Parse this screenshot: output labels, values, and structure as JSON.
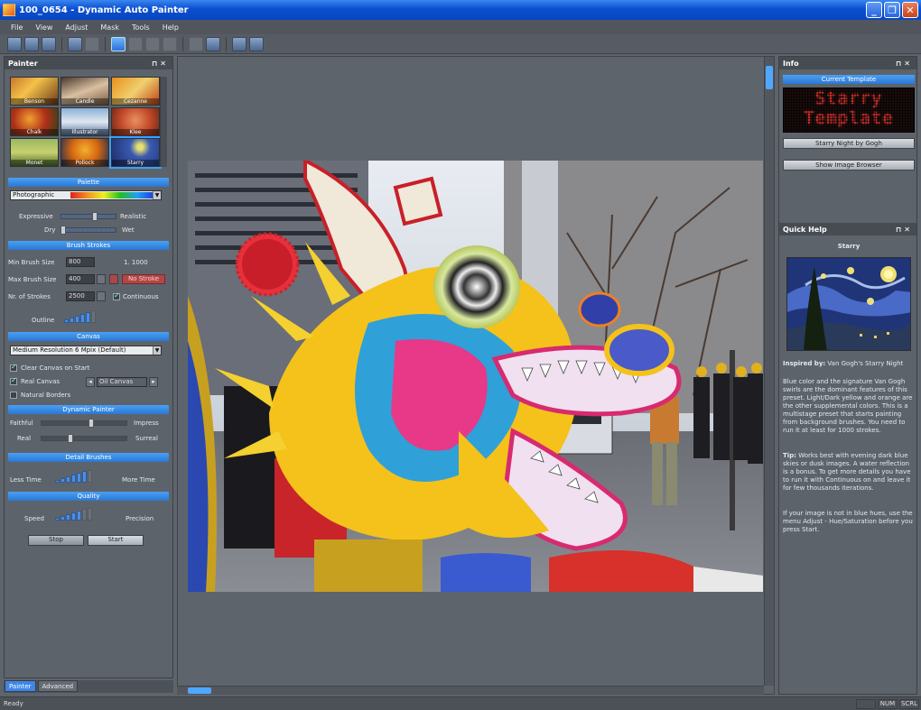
{
  "window": {
    "title": "100_0654 - Dynamic Auto Painter"
  },
  "menu": [
    "File",
    "View",
    "Adjust",
    "Mask",
    "Tools",
    "Help"
  ],
  "painter_panel": {
    "title": "Painter",
    "thumbnails": [
      "Benson",
      "Candle",
      "Cezanne",
      "Chalk",
      "Illustrator",
      "Klee",
      "Monet",
      "Pollock",
      "Starry"
    ],
    "palette": {
      "header": "Palette",
      "value": "Photographic",
      "expressive_label": "Expressive",
      "realistic_label": "Realistic",
      "dry_label": "Dry",
      "wet_label": "Wet"
    },
    "brush_strokes": {
      "header": "Brush Strokes",
      "min_label": "Min Brush Size",
      "min_value": "800",
      "ratio": "1. 1000",
      "max_label": "Max Brush Size",
      "max_value": "400",
      "no_stroke_label": "No Stroke",
      "strokes_label": "Nr. of Strokes",
      "strokes_value": "2500",
      "continuous_label": "Continuous",
      "outline_label": "Outline"
    },
    "canvas": {
      "header": "Canvas",
      "resolution": "Medium Resolution 6 Mpix (Default)",
      "clear_label": "Clear Canvas on Start",
      "real_canvas_label": "Real Canvas",
      "canvas_type": "Oil Canvas",
      "natural_borders_label": "Natural Borders"
    },
    "dynamic_painter": {
      "header": "Dynamic Painter",
      "faithful_label": "Faithful",
      "impress_label": "Impress",
      "real_label": "Real",
      "surreal_label": "Surreal"
    },
    "detail_brushes": {
      "header": "Detail Brushes",
      "less_label": "Less Time",
      "more_label": "More Time"
    },
    "quality": {
      "header": "Quality",
      "speed_label": "Speed",
      "precision_label": "Precision"
    },
    "stop_label": "Stop",
    "start_label": "Start",
    "tabs": [
      "Painter",
      "Advanced"
    ]
  },
  "info_panel": {
    "title": "Info",
    "current_template_label": "Current Template",
    "led_line1": "Starry",
    "led_line2": "Template",
    "template_name": "Starry Night by Gogh",
    "show_browser_label": "Show Image Browser"
  },
  "quick_help": {
    "title": "Quick Help",
    "name": "Starry",
    "inspired_label": "Inspired by:",
    "inspired_value": "Van Gogh's Starry Night",
    "paragraph1": "Blue color and the signature Van Gogh swirls are the dominant features of this preset. Light/Dark yellow and orange are the other supplemental colors. This is a multistage preset that starts painting from background brushes. You need to run it at least for 1000 strokes.",
    "tip_label": "Tip:",
    "tip_text": "Works best with evening dark blue skies or dusk images. A water reflection is a bonus. To get more details you have to run it with Continuous on and leave it for few thousands iterations.",
    "paragraph3": "If your image is not in blue hues, use the menu Adjust - Hue/Saturation before you press Start."
  },
  "status": {
    "text": "Ready",
    "num": "NUM",
    "scrl": "SCRL"
  }
}
